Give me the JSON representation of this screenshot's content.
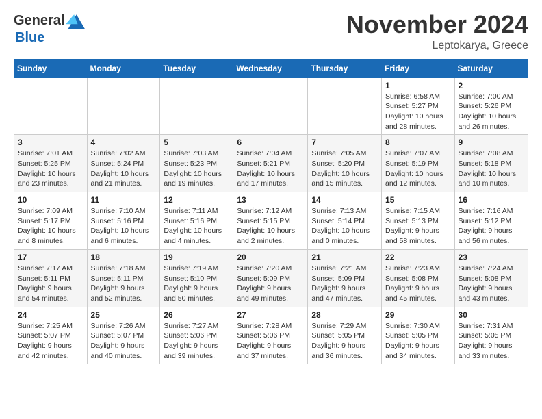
{
  "logo": {
    "general": "General",
    "blue": "Blue"
  },
  "title": "November 2024",
  "subtitle": "Leptokarya, Greece",
  "days_header": [
    "Sunday",
    "Monday",
    "Tuesday",
    "Wednesday",
    "Thursday",
    "Friday",
    "Saturday"
  ],
  "weeks": [
    [
      {
        "day": "",
        "info": ""
      },
      {
        "day": "",
        "info": ""
      },
      {
        "day": "",
        "info": ""
      },
      {
        "day": "",
        "info": ""
      },
      {
        "day": "",
        "info": ""
      },
      {
        "day": "1",
        "info": "Sunrise: 6:58 AM\nSunset: 5:27 PM\nDaylight: 10 hours and 28 minutes."
      },
      {
        "day": "2",
        "info": "Sunrise: 7:00 AM\nSunset: 5:26 PM\nDaylight: 10 hours and 26 minutes."
      }
    ],
    [
      {
        "day": "3",
        "info": "Sunrise: 7:01 AM\nSunset: 5:25 PM\nDaylight: 10 hours and 23 minutes."
      },
      {
        "day": "4",
        "info": "Sunrise: 7:02 AM\nSunset: 5:24 PM\nDaylight: 10 hours and 21 minutes."
      },
      {
        "day": "5",
        "info": "Sunrise: 7:03 AM\nSunset: 5:23 PM\nDaylight: 10 hours and 19 minutes."
      },
      {
        "day": "6",
        "info": "Sunrise: 7:04 AM\nSunset: 5:21 PM\nDaylight: 10 hours and 17 minutes."
      },
      {
        "day": "7",
        "info": "Sunrise: 7:05 AM\nSunset: 5:20 PM\nDaylight: 10 hours and 15 minutes."
      },
      {
        "day": "8",
        "info": "Sunrise: 7:07 AM\nSunset: 5:19 PM\nDaylight: 10 hours and 12 minutes."
      },
      {
        "day": "9",
        "info": "Sunrise: 7:08 AM\nSunset: 5:18 PM\nDaylight: 10 hours and 10 minutes."
      }
    ],
    [
      {
        "day": "10",
        "info": "Sunrise: 7:09 AM\nSunset: 5:17 PM\nDaylight: 10 hours and 8 minutes."
      },
      {
        "day": "11",
        "info": "Sunrise: 7:10 AM\nSunset: 5:16 PM\nDaylight: 10 hours and 6 minutes."
      },
      {
        "day": "12",
        "info": "Sunrise: 7:11 AM\nSunset: 5:16 PM\nDaylight: 10 hours and 4 minutes."
      },
      {
        "day": "13",
        "info": "Sunrise: 7:12 AM\nSunset: 5:15 PM\nDaylight: 10 hours and 2 minutes."
      },
      {
        "day": "14",
        "info": "Sunrise: 7:13 AM\nSunset: 5:14 PM\nDaylight: 10 hours and 0 minutes."
      },
      {
        "day": "15",
        "info": "Sunrise: 7:15 AM\nSunset: 5:13 PM\nDaylight: 9 hours and 58 minutes."
      },
      {
        "day": "16",
        "info": "Sunrise: 7:16 AM\nSunset: 5:12 PM\nDaylight: 9 hours and 56 minutes."
      }
    ],
    [
      {
        "day": "17",
        "info": "Sunrise: 7:17 AM\nSunset: 5:11 PM\nDaylight: 9 hours and 54 minutes."
      },
      {
        "day": "18",
        "info": "Sunrise: 7:18 AM\nSunset: 5:11 PM\nDaylight: 9 hours and 52 minutes."
      },
      {
        "day": "19",
        "info": "Sunrise: 7:19 AM\nSunset: 5:10 PM\nDaylight: 9 hours and 50 minutes."
      },
      {
        "day": "20",
        "info": "Sunrise: 7:20 AM\nSunset: 5:09 PM\nDaylight: 9 hours and 49 minutes."
      },
      {
        "day": "21",
        "info": "Sunrise: 7:21 AM\nSunset: 5:09 PM\nDaylight: 9 hours and 47 minutes."
      },
      {
        "day": "22",
        "info": "Sunrise: 7:23 AM\nSunset: 5:08 PM\nDaylight: 9 hours and 45 minutes."
      },
      {
        "day": "23",
        "info": "Sunrise: 7:24 AM\nSunset: 5:08 PM\nDaylight: 9 hours and 43 minutes."
      }
    ],
    [
      {
        "day": "24",
        "info": "Sunrise: 7:25 AM\nSunset: 5:07 PM\nDaylight: 9 hours and 42 minutes."
      },
      {
        "day": "25",
        "info": "Sunrise: 7:26 AM\nSunset: 5:07 PM\nDaylight: 9 hours and 40 minutes."
      },
      {
        "day": "26",
        "info": "Sunrise: 7:27 AM\nSunset: 5:06 PM\nDaylight: 9 hours and 39 minutes."
      },
      {
        "day": "27",
        "info": "Sunrise: 7:28 AM\nSunset: 5:06 PM\nDaylight: 9 hours and 37 minutes."
      },
      {
        "day": "28",
        "info": "Sunrise: 7:29 AM\nSunset: 5:05 PM\nDaylight: 9 hours and 36 minutes."
      },
      {
        "day": "29",
        "info": "Sunrise: 7:30 AM\nSunset: 5:05 PM\nDaylight: 9 hours and 34 minutes."
      },
      {
        "day": "30",
        "info": "Sunrise: 7:31 AM\nSunset: 5:05 PM\nDaylight: 9 hours and 33 minutes."
      }
    ]
  ]
}
